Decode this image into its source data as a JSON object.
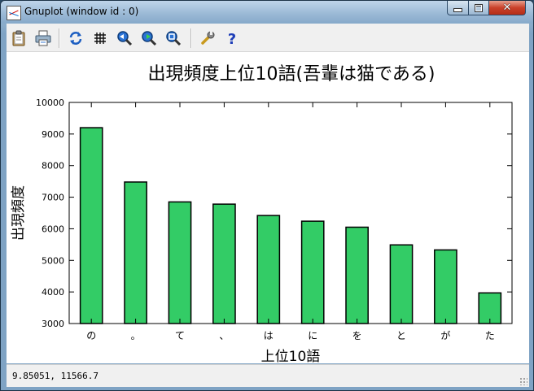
{
  "window": {
    "title": "Gnuplot (window id : 0)",
    "min_icon": "minimize-icon",
    "max_icon": "maximize-icon",
    "close_icon": "close-icon",
    "close_glyph": "✕"
  },
  "toolbar": {
    "buttons": [
      {
        "name": "copy-to-clipboard-button",
        "icon": "clipboard-icon"
      },
      {
        "name": "print-button",
        "icon": "printer-icon"
      },
      {
        "name": "replot-button",
        "icon": "refresh-icon"
      },
      {
        "name": "grid-button",
        "icon": "grid-icon",
        "glyph": "#"
      },
      {
        "name": "zoom-previous-button",
        "icon": "zoom-previous-icon"
      },
      {
        "name": "zoom-next-button",
        "icon": "zoom-next-icon"
      },
      {
        "name": "autoscale-button",
        "icon": "autoscale-icon"
      },
      {
        "name": "options-button",
        "icon": "wrench-icon"
      },
      {
        "name": "help-button",
        "icon": "help-icon",
        "glyph": "?"
      }
    ]
  },
  "colors": {
    "bar_fill": "#33cc66",
    "bar_stroke": "#000000"
  },
  "chart_data": {
    "type": "bar",
    "title": "出現頻度上位10語(吾輩は猫である)",
    "xlabel": "上位10語",
    "ylabel": "出現頻度",
    "categories": [
      "の",
      "。",
      "て",
      "、",
      "は",
      "に",
      "を",
      "と",
      "が",
      "た"
    ],
    "values": [
      9200,
      7480,
      6850,
      6780,
      6420,
      6240,
      6050,
      5490,
      5330,
      3970
    ],
    "ylim": [
      3000,
      10000
    ],
    "yticks": [
      3000,
      4000,
      5000,
      6000,
      7000,
      8000,
      9000,
      10000
    ],
    "grid": false,
    "legend": "none"
  },
  "status": {
    "coords": "9.85051,  11566.7"
  }
}
